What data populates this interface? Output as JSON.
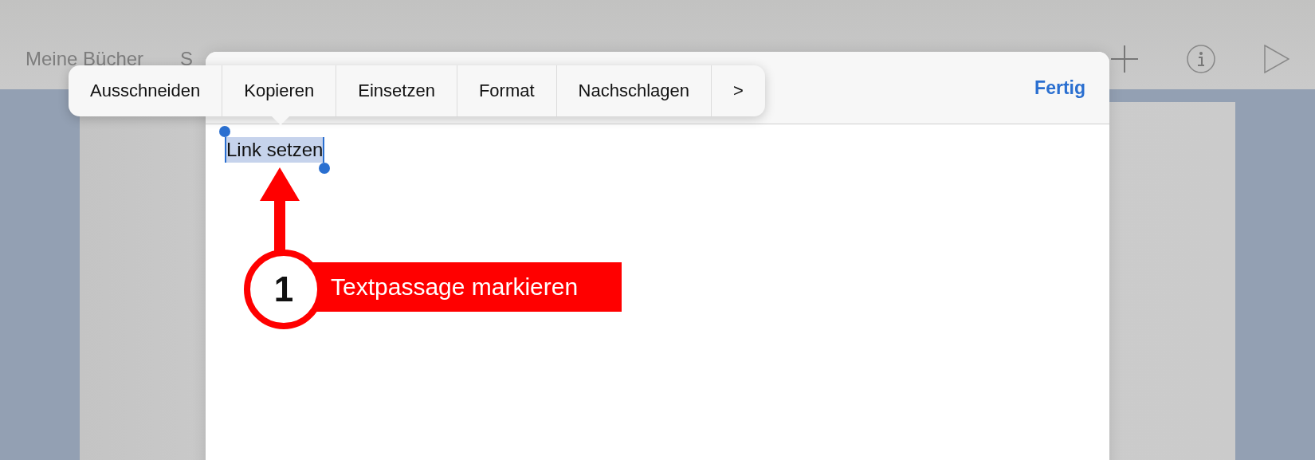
{
  "toolbar": {
    "left_items": [
      "Meine Bücher",
      "S"
    ]
  },
  "editor": {
    "done_button": "Fertig",
    "selected_text": "Link setzen"
  },
  "edit_menu": {
    "items": [
      "Ausschneiden",
      "Kopieren",
      "Einsetzen",
      "Format",
      "Nachschlagen",
      ">"
    ]
  },
  "annotation": {
    "number": "1",
    "text": "Textpassage markieren"
  }
}
